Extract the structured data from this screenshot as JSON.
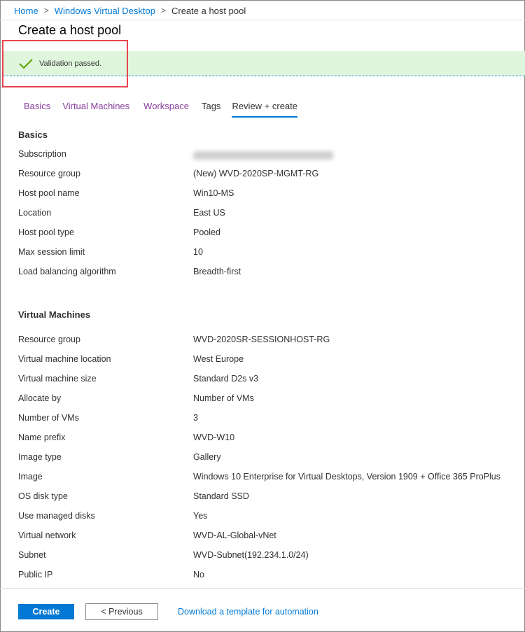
{
  "breadcrumb": {
    "items": [
      "Home",
      "Windows Virtual Desktop",
      "Create a host pool"
    ]
  },
  "page": {
    "title": "Create a host pool"
  },
  "validation": {
    "message": "Validation passed."
  },
  "tabs": [
    {
      "label": "Basics"
    },
    {
      "label": "Virtual Machines"
    },
    {
      "label": "Workspace"
    },
    {
      "label": "Tags"
    },
    {
      "label": "Review + create"
    }
  ],
  "basics": {
    "heading": "Basics",
    "rows": [
      {
        "label": "Subscription",
        "value": ""
      },
      {
        "label": "Resource group",
        "value": "(New) WVD-2020SP-MGMT-RG"
      },
      {
        "label": "Host pool name",
        "value": "Win10-MS"
      },
      {
        "label": "Location",
        "value": "East US"
      },
      {
        "label": "Host pool type",
        "value": "Pooled"
      },
      {
        "label": "Max session limit",
        "value": "10"
      },
      {
        "label": "Load balancing algorithm",
        "value": "Breadth-first"
      }
    ]
  },
  "virtual_machines": {
    "heading": "Virtual Machines",
    "rows": [
      {
        "label": "Resource group",
        "value": "WVD-2020SR-SESSIONHOST-RG"
      },
      {
        "label": "Virtual machine location",
        "value": "West Europe"
      },
      {
        "label": "Virtual machine size",
        "value": "Standard D2s v3"
      },
      {
        "label": "Allocate by",
        "value": "Number of VMs"
      },
      {
        "label": "Number of VMs",
        "value": "3"
      },
      {
        "label": "Name prefix",
        "value": "WVD-W10"
      },
      {
        "label": "Image type",
        "value": "Gallery"
      },
      {
        "label": "Image",
        "value": "Windows 10 Enterprise for Virtual Desktops, Version 1909 + Office 365 ProPlus"
      },
      {
        "label": "OS disk type",
        "value": "Standard SSD"
      },
      {
        "label": "Use managed disks",
        "value": "Yes"
      },
      {
        "label": "Virtual network",
        "value": "WVD-AL-Global-vNet"
      },
      {
        "label": "Subnet",
        "value": "WVD-Subnet(192.234.1.0/24)"
      },
      {
        "label": "Public IP",
        "value": "No"
      }
    ]
  },
  "footer": {
    "create_label": "Create",
    "previous_label": "< Previous",
    "download_label": "Download a template for automation"
  },
  "colors": {
    "accent": "#0078d4",
    "success_banner": "#dff6dd",
    "success_check": "#57a300",
    "highlight": "#e8444e",
    "visited_link": "#8a3f9d"
  },
  "icons": {
    "validation": "checkmark-icon",
    "separator": "chevron-right-icon"
  }
}
